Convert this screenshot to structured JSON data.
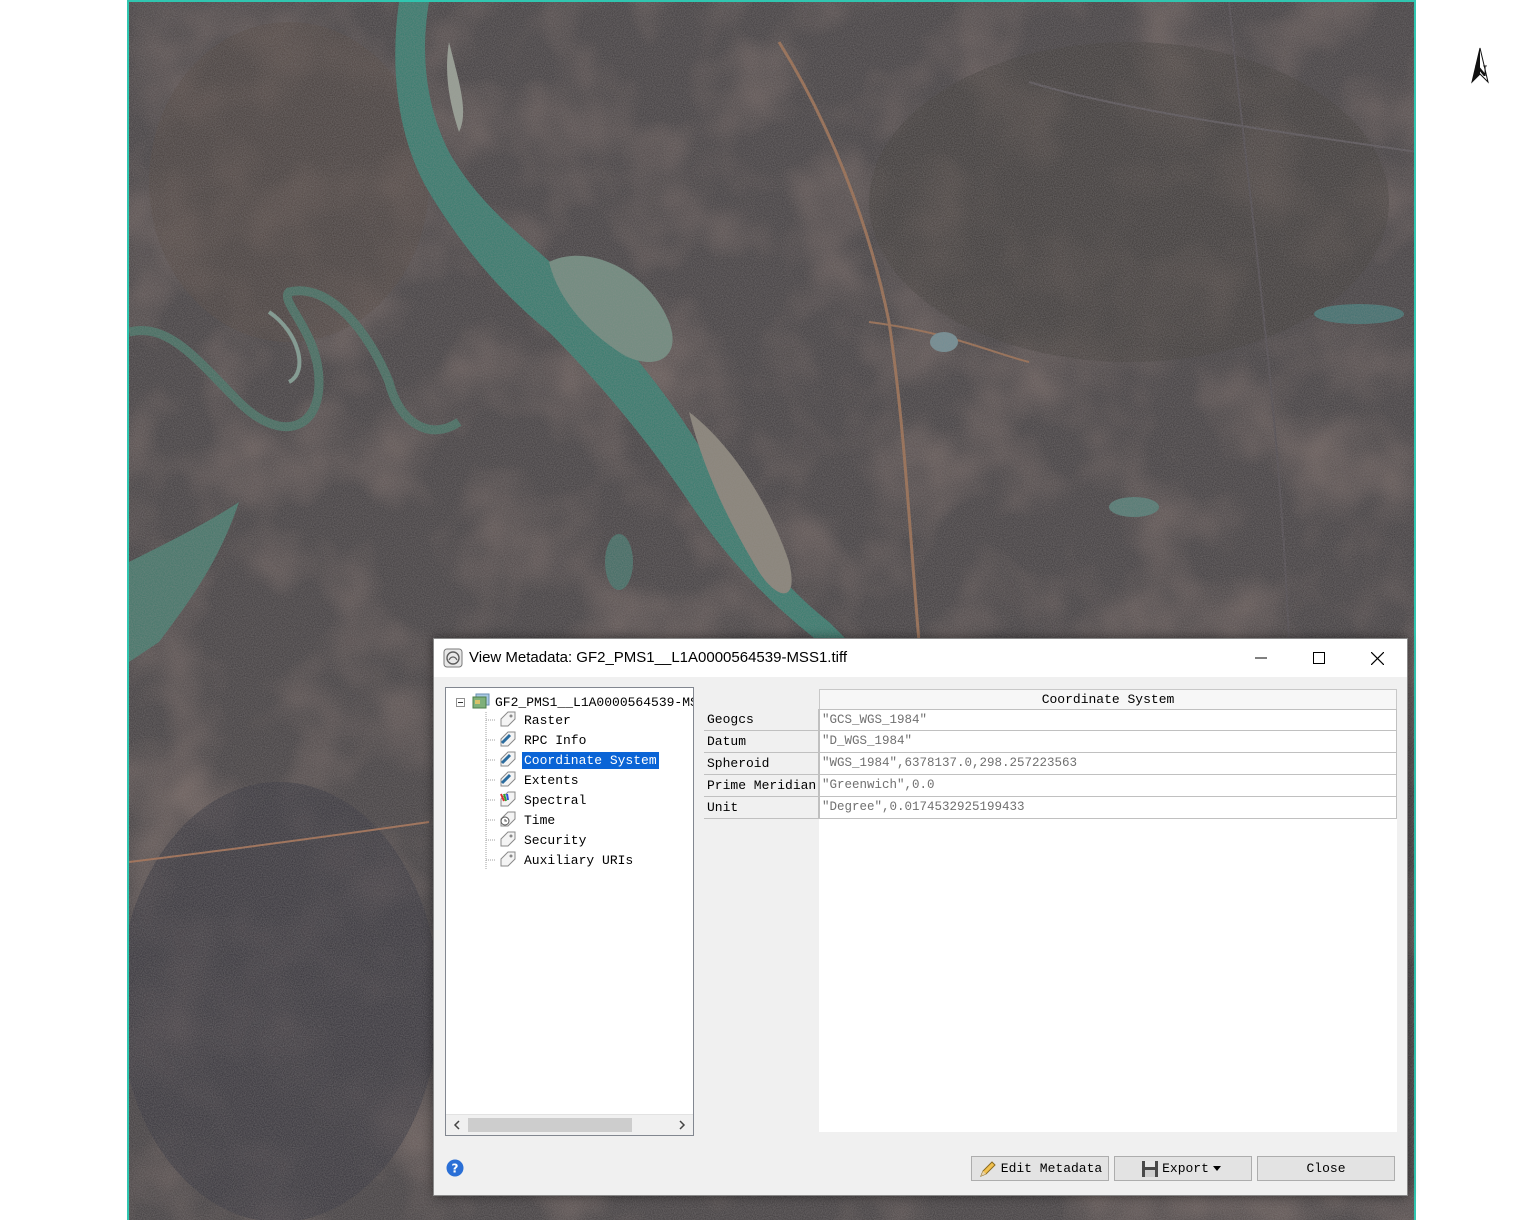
{
  "dialog": {
    "title": "View Metadata: GF2_PMS1__L1A0000564539-MSS1.tiff",
    "window_buttons": {
      "minimize": "minimize-icon",
      "maximize": "maximize-icon",
      "close": "close-icon"
    }
  },
  "tree": {
    "root_label": "GF2_PMS1__L1A0000564539-MS",
    "items": [
      {
        "label": "Raster",
        "icon": "tag-icon"
      },
      {
        "label": "RPC Info",
        "icon": "tag-icon"
      },
      {
        "label": "Coordinate System",
        "icon": "tag-icon",
        "selected": true
      },
      {
        "label": "Extents",
        "icon": "tag-icon"
      },
      {
        "label": "Spectral",
        "icon": "spectral-tag-icon"
      },
      {
        "label": "Time",
        "icon": "time-tag-icon"
      },
      {
        "label": "Security",
        "icon": "tag-icon"
      },
      {
        "label": "Auxiliary URIs",
        "icon": "tag-icon"
      }
    ]
  },
  "properties": {
    "header": "Coordinate System",
    "rows": [
      {
        "key": "Geogcs",
        "value": "\"GCS_WGS_1984\""
      },
      {
        "key": "Datum",
        "value": "\"D_WGS_1984\""
      },
      {
        "key": "Spheroid",
        "value": "\"WGS_1984\",6378137.0,298.257223563"
      },
      {
        "key": "Prime Meridian",
        "value": "\"Greenwich\",0.0"
      },
      {
        "key": "Unit",
        "value": "\"Degree\",0.0174532925199433"
      }
    ]
  },
  "buttons": {
    "edit_metadata": "Edit Metadata",
    "export": "Export",
    "close": "Close"
  },
  "colors": {
    "selection": "#0a64d6",
    "map_border": "#30c6b0",
    "help_icon": "#2a6fd6"
  }
}
